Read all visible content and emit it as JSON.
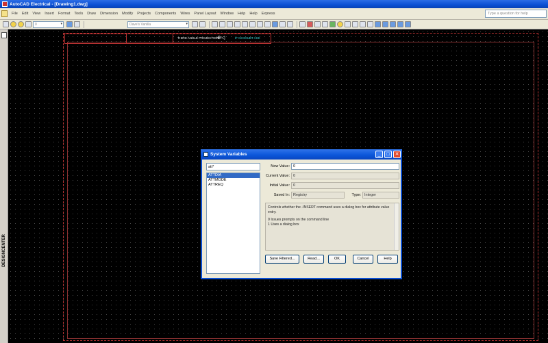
{
  "window": {
    "title": "AutoCAD Electrical - [Drawing1.dwg]"
  },
  "menu": {
    "items": [
      "File",
      "Edit",
      "View",
      "Insert",
      "Format",
      "Tools",
      "Draw",
      "Dimension",
      "Modify",
      "Projects",
      "Components",
      "Wires",
      "Panel Layout",
      "Window",
      "Help",
      "Help",
      "Express"
    ],
    "help_placeholder": "Type a question for help"
  },
  "toolbar": {
    "layer_value": "0",
    "style_value": "Dave's Vanilla"
  },
  "left_panel": {
    "label": "DESIGNCENTER"
  },
  "drawing": {
    "projection_note": "THIRD ANGLE PROJECTION",
    "scale_note": "IF IN DOUBT ASK"
  },
  "dialog": {
    "title": "System Variables",
    "filter": "att*",
    "variables": [
      "ATTDIA",
      "ATTMODE",
      "ATTREQ"
    ],
    "selected_index": 0,
    "new_value_label": "New Value:",
    "new_value": "0",
    "current_value_label": "Current Value:",
    "current_value": "0",
    "initial_value_label": "Initial Value:",
    "initial_value": "0",
    "saved_in_label": "Saved In:",
    "saved_in": "Registry",
    "type_label": "Type:",
    "type": "Integer",
    "description": "Controls whether the -INSERT command uses a dialog box for attribute value entry.",
    "option_0": "0     Issues prompts on the command line",
    "option_1": "1     Uses a dialog box",
    "buttons": {
      "save_filtered": "Save Filtered...",
      "read": "Read...",
      "ok": "OK",
      "cancel": "Cancel",
      "help": "Help"
    }
  }
}
